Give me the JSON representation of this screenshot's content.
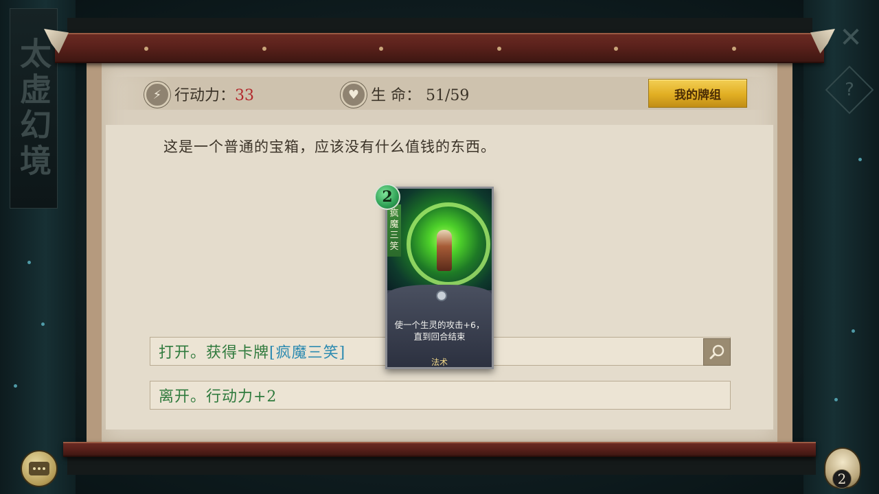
{
  "side": {
    "title_vertical": "太虚幻境",
    "close_icon": "close-icon",
    "help_label": "?"
  },
  "stats": {
    "action_label": "行动力：",
    "action_value": "33",
    "life_label": "生 命：",
    "life_value": "51/59",
    "action_icon": "lightning-icon",
    "life_icon": "heart-icon"
  },
  "deck_button": "我的牌组",
  "description": "这是一个普通的宝箱，应该没有什么值钱的东西。",
  "card": {
    "cost": "2",
    "name_chars": [
      "疯",
      "魔",
      "三",
      "笑"
    ],
    "text": "使一个生灵的攻击+6，直到回合结束",
    "type": "法术"
  },
  "options": [
    {
      "text": "打开。获得卡牌",
      "card_ref": "[疯魔三笑]"
    },
    {
      "text": "离开。行动力+2"
    }
  ],
  "bottom": {
    "pack_count": "2"
  },
  "colors": {
    "action_value": "#b2282c",
    "option_text": "#2f7a3d",
    "card_ref": "#2c8ab0",
    "deck_button": "#e1ae23"
  }
}
